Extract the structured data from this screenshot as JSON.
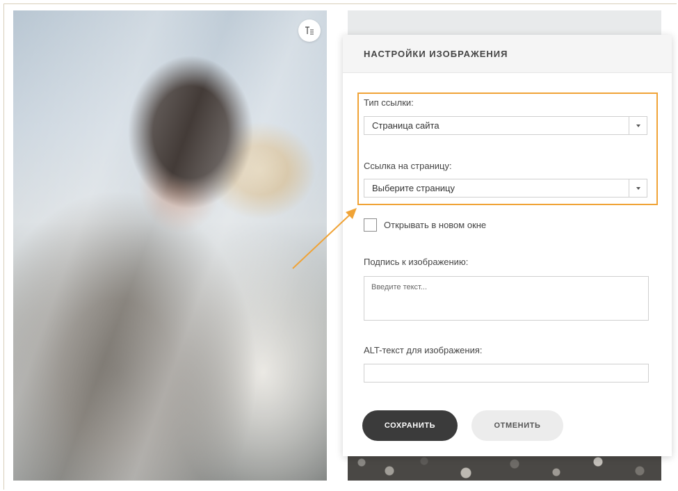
{
  "panel": {
    "title": "НАСТРОЙКИ ИЗОБРАЖЕНИЯ",
    "link_type": {
      "label": "Тип ссылки:",
      "value": "Страница сайта"
    },
    "page_link": {
      "label": "Ссылка на страницу:",
      "value": "Выберите страницу"
    },
    "new_window": {
      "label": "Открывать в новом окне",
      "checked": false
    },
    "caption": {
      "label": "Подпись к изображению:",
      "placeholder": "Введите текст..."
    },
    "alt_text": {
      "label": "ALT-текст для изображения:",
      "value": ""
    },
    "buttons": {
      "save": "СОХРАНИТЬ",
      "cancel": "ОТМЕНИТЬ"
    }
  },
  "colors": {
    "highlight": "#f0a336",
    "save_button": "#3b3b3b",
    "cancel_button": "#ececec"
  },
  "icons": {
    "image_settings_toggle": "text-settings-icon",
    "dropdown": "caret-down-icon",
    "annotation": "arrow-icon"
  }
}
